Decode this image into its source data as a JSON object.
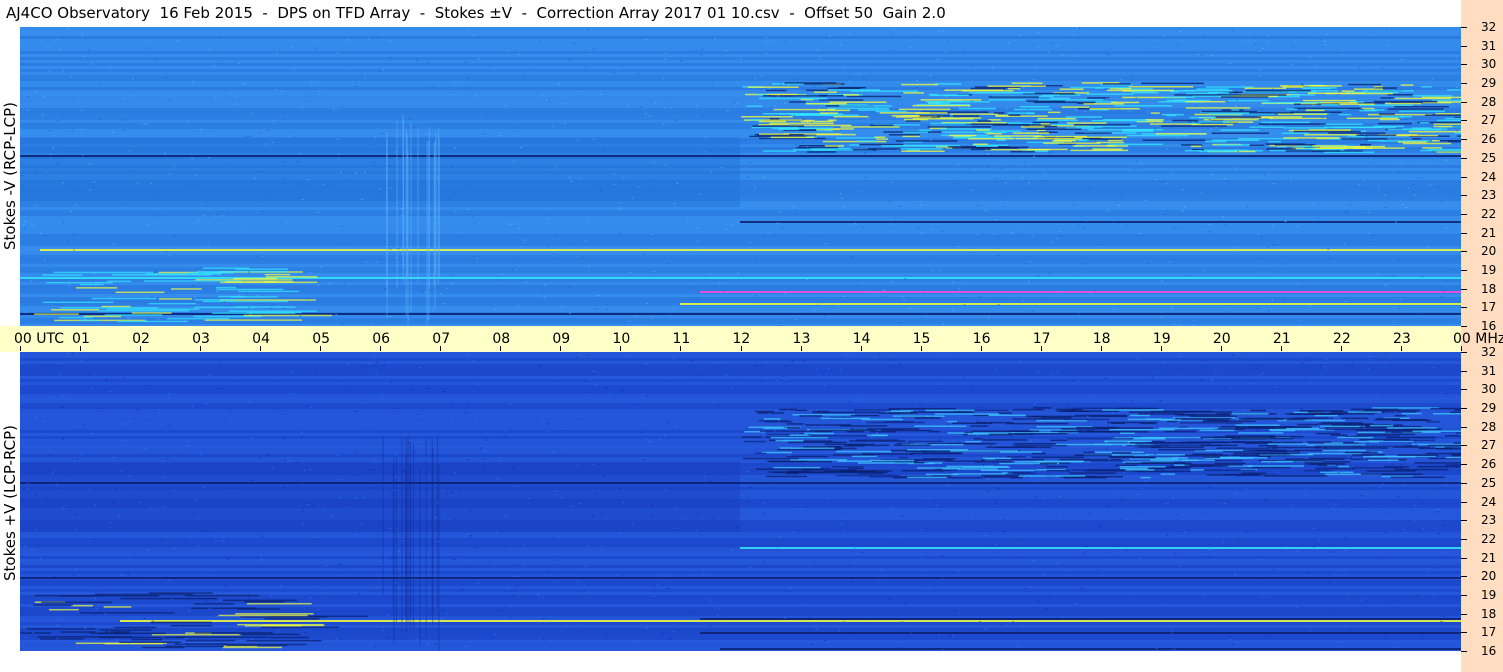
{
  "title": "AJ4CO Observatory  16 Feb 2015  -  DPS on TFD Array  -  Stokes ±V  -  Correction Array 2017 01 10.csv  -  Offset 50  Gain 2.0",
  "colors": {
    "panel_top_base": "#2f86e8",
    "panel_bottom_base": "#1f4fd4",
    "time_axis_bg": "#ffffc8",
    "freq_axis_bg": "#ffddc0",
    "activity_cyan": "#33e6ff",
    "activity_yellow": "#f4ff3a",
    "activity_dark": "#0a1f6e"
  },
  "chart_data": [
    {
      "type": "heatmap",
      "title": "AJ4CO Observatory  16 Feb 2015  -  DPS on TFD Array  -  Stokes ±V  -  Correction Array 2017 01 10.csv  -  Offset 50  Gain 2.0",
      "ylabel": "Stokes -V (RCP-LCP)",
      "xlabel": "UTC",
      "x_ticks": [
        "00",
        "01",
        "02",
        "03",
        "04",
        "05",
        "06",
        "07",
        "08",
        "09",
        "10",
        "11",
        "12",
        "13",
        "14",
        "15",
        "16",
        "17",
        "18",
        "19",
        "20",
        "21",
        "22",
        "23",
        "00"
      ],
      "x_unit_label": "UTC",
      "y_ticks": [
        "16",
        "17",
        "18",
        "19",
        "20",
        "21",
        "22",
        "23",
        "24",
        "25",
        "26",
        "27",
        "28",
        "29",
        "30",
        "31",
        "32"
      ],
      "y_unit_label": "MHz",
      "ylim": [
        16,
        32
      ],
      "xlim": [
        0,
        24
      ]
    },
    {
      "type": "heatmap",
      "ylabel": "Stokes +V (LCP-RCP)",
      "xlabel": "UTC",
      "x_ticks": [
        "00",
        "01",
        "02",
        "03",
        "04",
        "05",
        "06",
        "07",
        "08",
        "09",
        "10",
        "11",
        "12",
        "13",
        "14",
        "15",
        "16",
        "17",
        "18",
        "19",
        "20",
        "21",
        "22",
        "23",
        "00"
      ],
      "y_ticks": [
        "16",
        "17",
        "18",
        "19",
        "20",
        "21",
        "22",
        "23",
        "24",
        "25",
        "26",
        "27",
        "28",
        "29",
        "30",
        "31",
        "32"
      ],
      "y_unit_label": "MHz",
      "ylim": [
        16,
        32
      ],
      "xlim": [
        0,
        24
      ]
    }
  ]
}
